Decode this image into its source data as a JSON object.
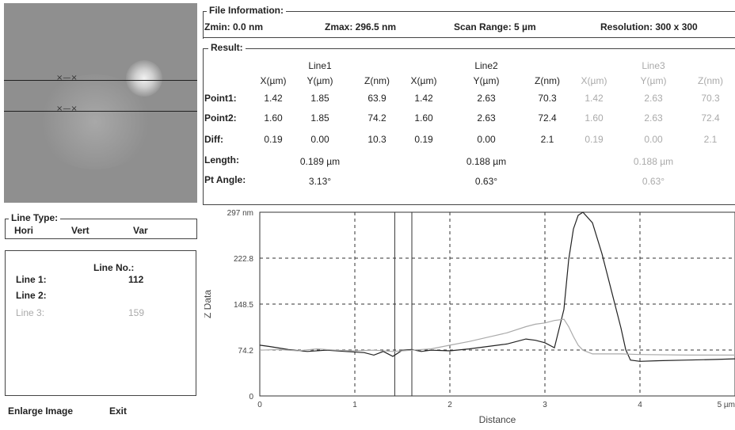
{
  "file_info": {
    "title": "File Information:",
    "zmin": "Zmin: 0.0 nm",
    "zmax": "Zmax: 296.5 nm",
    "scan_range": "Scan Range: 5 µm",
    "resolution": "Resolution: 300 x 300"
  },
  "result": {
    "title": "Result:",
    "line_headers": [
      "Line1",
      "Line2",
      "Line3"
    ],
    "col_headers": [
      "X(µm)",
      "Y(µm)",
      "Z(nm)",
      "X(µm)",
      "Y(µm)",
      "Z(nm)",
      "X(µm)",
      "Y(µm)",
      "Z(nm)"
    ],
    "rows": [
      {
        "label": "Point1:",
        "values": [
          "1.42",
          "1.85",
          "63.9",
          "1.42",
          "2.63",
          "70.3",
          "1.42",
          "2.63",
          "70.3"
        ]
      },
      {
        "label": "Point2:",
        "values": [
          "1.60",
          "1.85",
          "74.2",
          "1.60",
          "2.63",
          "72.4",
          "1.60",
          "2.63",
          "72.4"
        ]
      },
      {
        "label": "Diff:",
        "values": [
          "0.19",
          "0.00",
          "10.3",
          "0.19",
          "0.00",
          "2.1",
          "0.19",
          "0.00",
          "2.1"
        ]
      }
    ],
    "length_label": "Length:",
    "length_values": [
      "0.189 µm",
      "0.188 µm",
      "0.188 µm"
    ],
    "angle_label": "Pt Angle:",
    "angle_values": [
      "3.13°",
      "0.63°",
      "0.63°"
    ]
  },
  "line_type": {
    "title": "Line Type:",
    "options": [
      "Hori",
      "Vert",
      "Var"
    ]
  },
  "line_no": {
    "header": "Line No.:",
    "lines": [
      {
        "label": "Line 1:",
        "value": "112"
      },
      {
        "label": "Line 2:",
        "value": ""
      },
      {
        "label": "Line 3:",
        "value": "159"
      }
    ]
  },
  "buttons": {
    "enlarge": "Enlarge Image",
    "exit": "Exit"
  },
  "chart_data": {
    "type": "line",
    "xlabel": "Distance",
    "ylabel": "Z Data",
    "xlim": [
      0,
      5
    ],
    "ylim": [
      0,
      297
    ],
    "x_ticks": [
      "0",
      "1",
      "2",
      "3",
      "4",
      "5 µm"
    ],
    "y_ticks": [
      "0",
      "74.2",
      "148.5",
      "222.8",
      "297 nm"
    ],
    "cursor_x": [
      1.42,
      1.6
    ],
    "series": [
      {
        "color": "#222222",
        "x": [
          0,
          0.1,
          0.3,
          0.5,
          0.7,
          0.9,
          1.1,
          1.2,
          1.3,
          1.4,
          1.5,
          1.6,
          1.7,
          1.8,
          2.0,
          2.2,
          2.4,
          2.6,
          2.8,
          2.9,
          3.0,
          3.1,
          3.2,
          3.25,
          3.3,
          3.35,
          3.4,
          3.5,
          3.6,
          3.7,
          3.8,
          3.85,
          3.9,
          4.0,
          4.2,
          4.5,
          4.8,
          5.0
        ],
        "y": [
          82,
          80,
          75,
          72,
          74,
          72,
          70,
          66,
          72,
          64,
          74,
          75,
          72,
          74,
          73,
          76,
          80,
          84,
          92,
          90,
          86,
          78,
          140,
          220,
          270,
          292,
          297,
          280,
          230,
          170,
          110,
          75,
          58,
          56,
          57,
          58,
          59,
          60
        ]
      },
      {
        "color": "#aaaaaa",
        "x": [
          0,
          0.2,
          0.4,
          0.6,
          0.8,
          1.0,
          1.2,
          1.4,
          1.6,
          1.8,
          2.0,
          2.2,
          2.4,
          2.6,
          2.8,
          2.9,
          3.0,
          3.1,
          3.2,
          3.25,
          3.3,
          3.35,
          3.4,
          3.5,
          3.6,
          3.8,
          4.0,
          4.5,
          5.0
        ],
        "y": [
          74,
          75,
          73,
          76,
          74,
          73,
          74,
          72,
          74,
          76,
          82,
          88,
          95,
          102,
          112,
          116,
          118,
          122,
          124,
          112,
          96,
          82,
          74,
          68,
          68,
          68,
          67,
          66,
          66
        ]
      }
    ]
  }
}
